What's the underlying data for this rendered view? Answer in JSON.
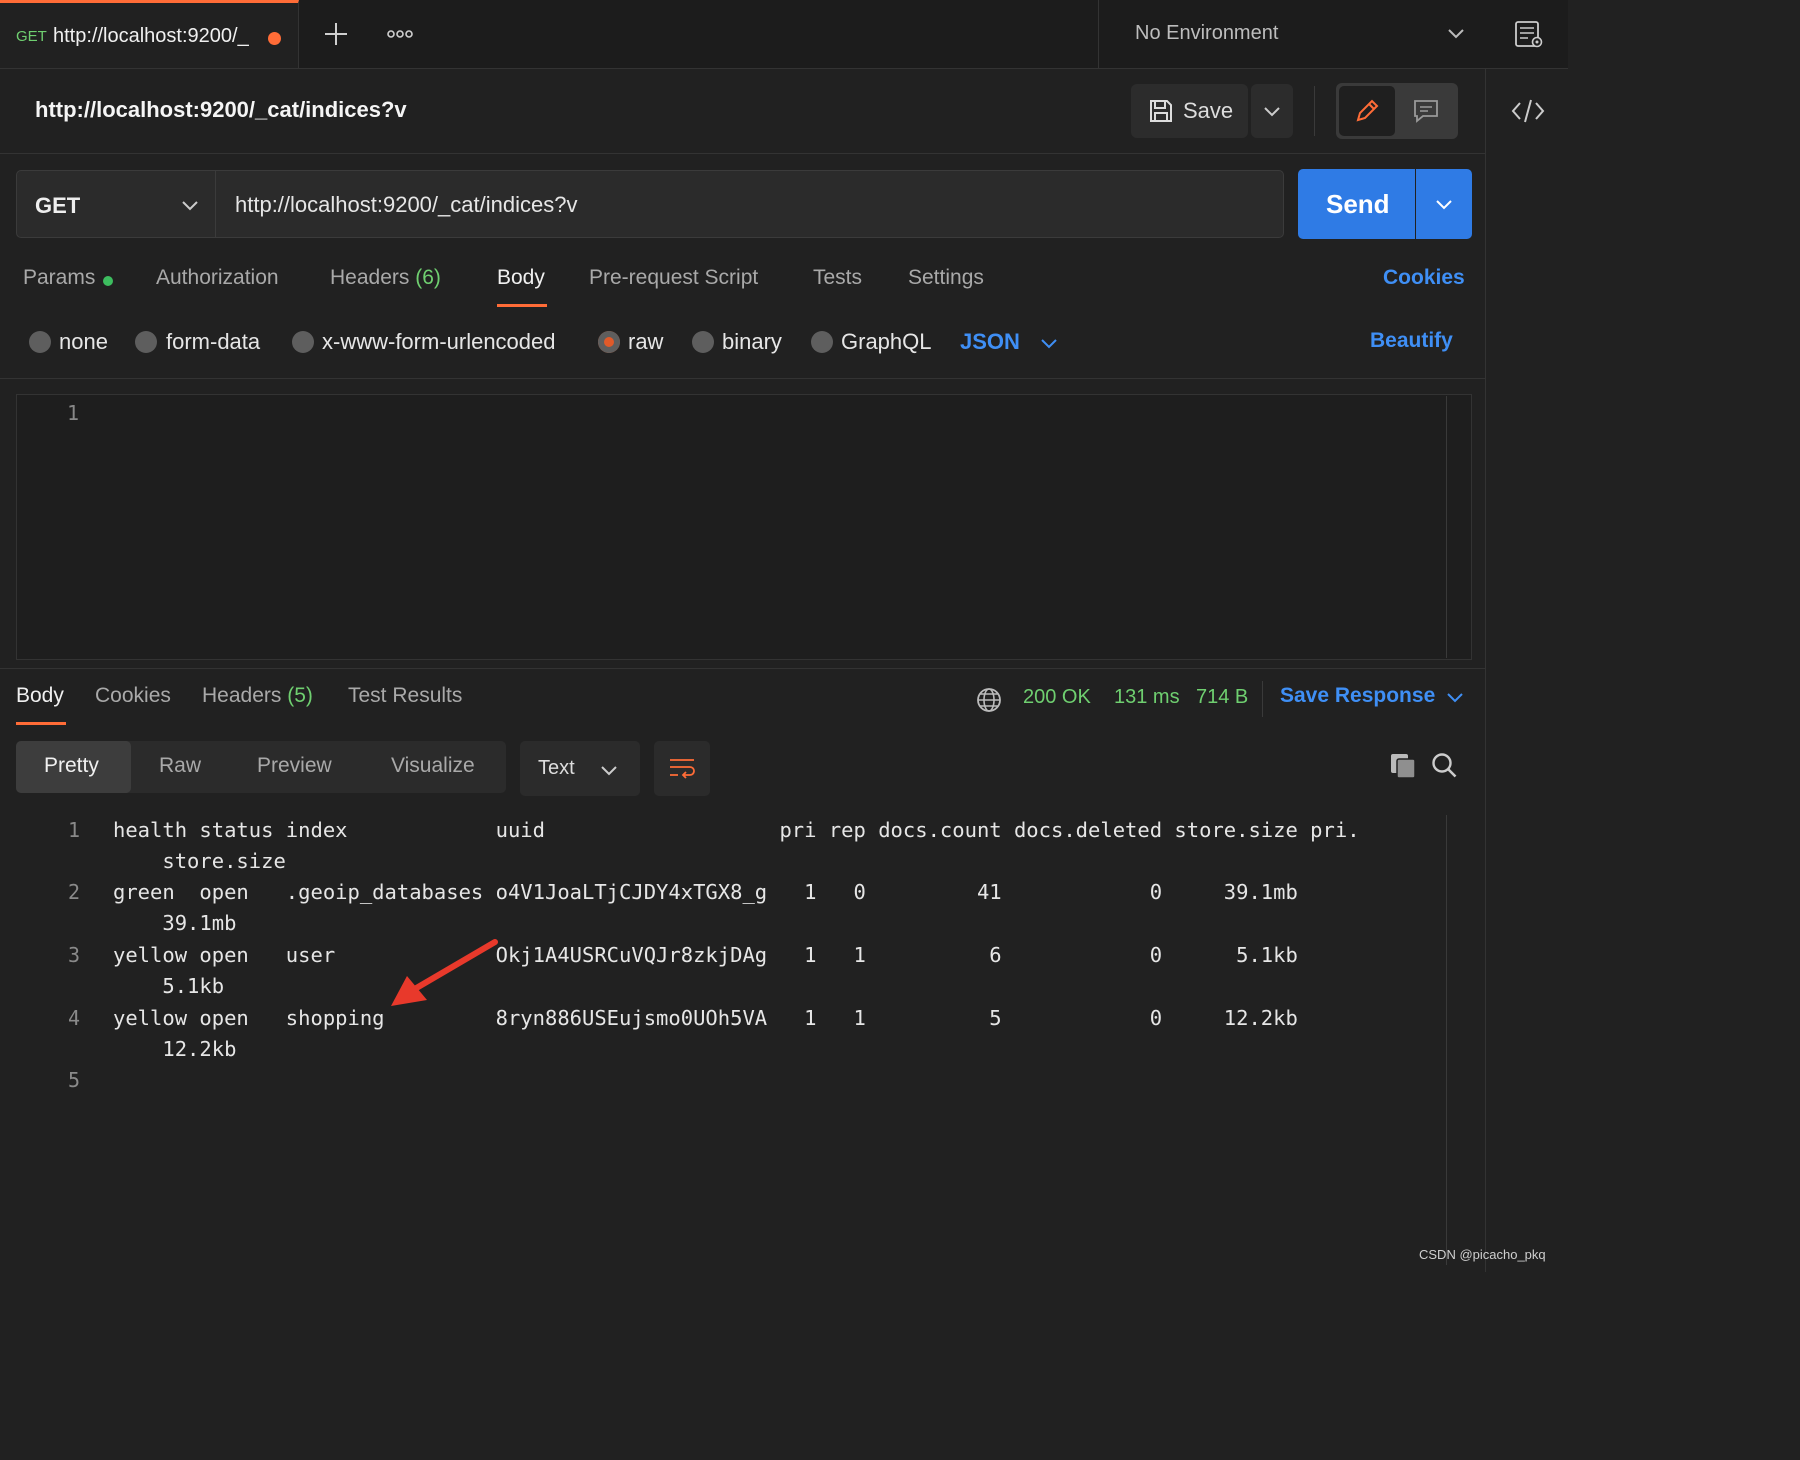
{
  "tab": {
    "method": "GET",
    "url": "http://localhost:9200/_"
  },
  "environment": {
    "label": "No Environment"
  },
  "request": {
    "title": "http://localhost:9200/_cat/indices?v",
    "save_label": "Save",
    "method": "GET",
    "url": "http://localhost:9200/_cat/indices?v",
    "send_label": "Send"
  },
  "request_tabs": {
    "params": "Params",
    "authorization": "Authorization",
    "headers": "Headers",
    "headers_count": "(6)",
    "body": "Body",
    "prerequest": "Pre-request Script",
    "tests": "Tests",
    "settings": "Settings",
    "cookies": "Cookies"
  },
  "body_types": {
    "none": "none",
    "form_data": "form-data",
    "urlencoded": "x-www-form-urlencoded",
    "raw": "raw",
    "binary": "binary",
    "graphql": "GraphQL",
    "format": "JSON",
    "beautify": "Beautify"
  },
  "editor": {
    "line1": "1"
  },
  "response_tabs": {
    "body": "Body",
    "cookies": "Cookies",
    "headers": "Headers",
    "headers_count": "(5)",
    "test_results": "Test Results"
  },
  "response_status": {
    "status": "200 OK",
    "time": "131 ms",
    "size": "714 B",
    "save_response": "Save Response"
  },
  "response_views": {
    "pretty": "Pretty",
    "raw": "Raw",
    "preview": "Preview",
    "visualize": "Visualize",
    "format": "Text"
  },
  "response_lines": [
    {
      "num": "1",
      "text": "health status index            uuid                   pri rep docs.count docs.deleted store.size pri.",
      "cont": "    store.size"
    },
    {
      "num": "2",
      "text": "green  open   .geoip_databases o4V1JoaLTjCJDY4xTGX8_g   1   0         41            0     39.1mb",
      "cont": "    39.1mb"
    },
    {
      "num": "3",
      "text": "yellow open   user             Okj1A4USRCuVQJr8zkjDAg   1   1          6            0      5.1kb",
      "cont": "    5.1kb"
    },
    {
      "num": "4",
      "text": "yellow open   shopping         8ryn886USEujsmo0UOh5VA   1   1          5            0     12.2kb",
      "cont": "    12.2kb"
    },
    {
      "num": "5",
      "text": "",
      "cont": ""
    }
  ],
  "watermark": "CSDN @picacho_pkq",
  "colors": {
    "accent": "#ff6c37",
    "link": "#3f8ff5",
    "send": "#2f7be5",
    "success": "#6fcf70"
  }
}
